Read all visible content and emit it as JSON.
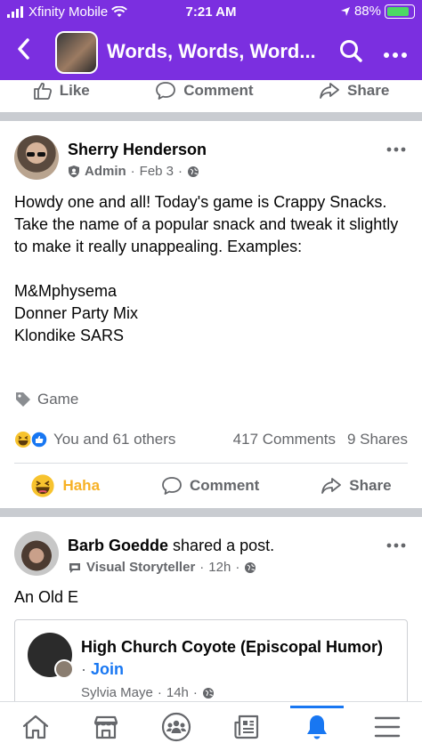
{
  "status": {
    "carrier": "Xfinity Mobile",
    "time": "7:21 AM",
    "battery": "88%",
    "battery_level": 0.88,
    "colors": {
      "bar": "#7b2fe0",
      "battery": "#4cd964"
    }
  },
  "nav": {
    "title": "Words, Words, Word..."
  },
  "prev_post_actions": {
    "like": "Like",
    "comment": "Comment",
    "share": "Share"
  },
  "post1": {
    "author": "Sherry Henderson",
    "role": "Admin",
    "date": "Feb 3",
    "text": "Howdy one and all! Today's game is Crappy Snacks. Take the name of a popular snack and tweak it slightly to make it really unappealing. Examples:\n\nM&Mphysema\nDonner Party Mix\nKlondike SARS",
    "tag": "Game",
    "reactions_text": "You and 61 others",
    "comments_count": "417 Comments",
    "shares_count": "9 Shares",
    "actions": {
      "reaction": "Haha",
      "comment": "Comment",
      "share": "Share"
    }
  },
  "post2": {
    "author": "Barb Goedde",
    "shared_text": "shared a post.",
    "badge": "Visual Storyteller",
    "time": "12h",
    "text": "An Old E",
    "shared": {
      "group": "High Church Coyote (Episcopal Humor)",
      "join": "Join",
      "author": "Sylvia Maye",
      "time": "14h"
    }
  },
  "tabs": [
    "home-tab",
    "marketplace-tab",
    "groups-tab",
    "news-tab",
    "notifications-tab",
    "menu-tab"
  ],
  "active_tab": "notifications-tab",
  "accent_color": "#1877f2"
}
